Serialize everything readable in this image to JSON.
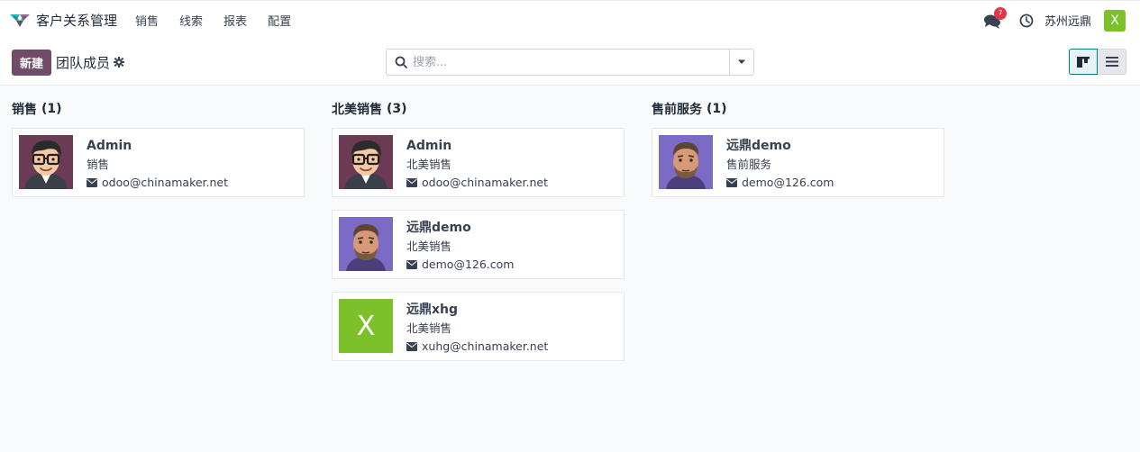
{
  "app": {
    "name": "客户关系管理",
    "menu": [
      "销售",
      "线索",
      "报表",
      "配置"
    ]
  },
  "header": {
    "chat_badge": "7",
    "company": "苏州远鼎",
    "user_initial": "X"
  },
  "control": {
    "new_label": "新建",
    "title": "团队成员",
    "search_placeholder": "搜索..."
  },
  "columns": [
    {
      "title": "销售",
      "count": "(1)",
      "cards": [
        {
          "name": "Admin",
          "team": "销售",
          "email": "odoo@chinamaker.net",
          "avatar": "admin"
        }
      ]
    },
    {
      "title": "北美销售",
      "count": "(3)",
      "cards": [
        {
          "name": "Admin",
          "team": "北美销售",
          "email": "odoo@chinamaker.net",
          "avatar": "admin"
        },
        {
          "name": "远鼎demo",
          "team": "北美销售",
          "email": "demo@126.com",
          "avatar": "demo"
        },
        {
          "name": "远鼎xhg",
          "team": "北美销售",
          "email": "xuhg@chinamaker.net",
          "avatar": "letter",
          "initial": "X"
        }
      ]
    },
    {
      "title": "售前服务",
      "count": "(1)",
      "cards": [
        {
          "name": "远鼎demo",
          "team": "售前服务",
          "email": "demo@126.com",
          "avatar": "demo"
        }
      ]
    }
  ],
  "colors": {
    "primary": "#714b67",
    "accent": "#017e84",
    "badge": "#e3344a",
    "avatar_green": "#7cc12c"
  }
}
